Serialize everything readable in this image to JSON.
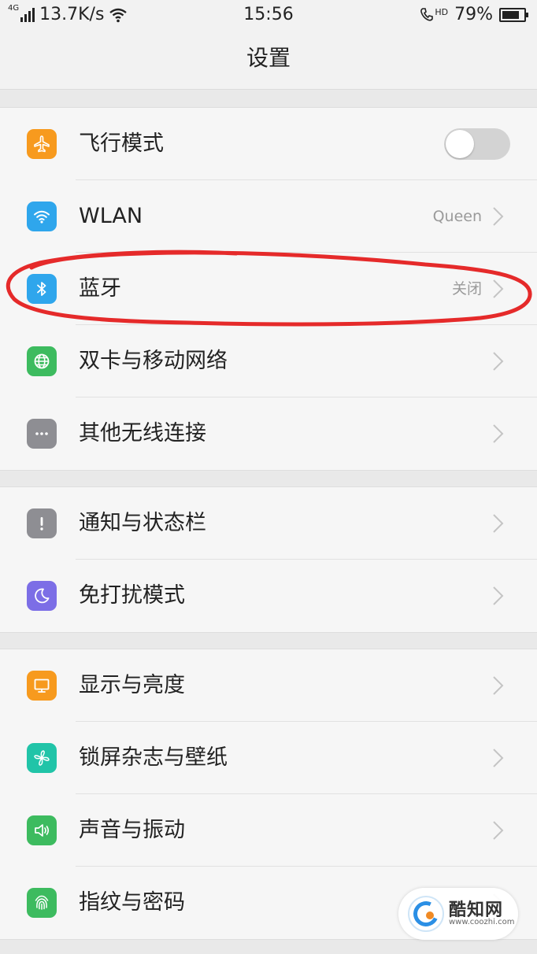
{
  "status_bar": {
    "network_type": "4G",
    "speed": "13.7K/s",
    "time": "15:56",
    "call_indicator": "HD",
    "battery_percent": "79%",
    "battery_level": 0.79
  },
  "header": {
    "title": "设置"
  },
  "groups": [
    {
      "items": [
        {
          "label": "飞行模式",
          "icon": "airplane-icon",
          "icon_color": "#f79a1e",
          "control": "toggle",
          "toggle_on": false
        },
        {
          "label": "WLAN",
          "icon": "wifi-icon",
          "icon_color": "#2fa6ec",
          "value": "Queen",
          "control": "chevron"
        },
        {
          "label": "蓝牙",
          "icon": "bluetooth-icon",
          "icon_color": "#2fa6ec",
          "value": "关闭",
          "control": "chevron"
        },
        {
          "label": "双卡与移动网络",
          "icon": "globe-icon",
          "icon_color": "#3dbb5f",
          "control": "chevron"
        },
        {
          "label": "其他无线连接",
          "icon": "more-icon",
          "icon_color": "#8e8e93",
          "control": "chevron"
        }
      ]
    },
    {
      "items": [
        {
          "label": "通知与状态栏",
          "icon": "notification-icon",
          "icon_color": "#8e8e93",
          "control": "chevron"
        },
        {
          "label": "免打扰模式",
          "icon": "moon-icon",
          "icon_color": "#7c6ee6",
          "control": "chevron"
        }
      ]
    },
    {
      "items": [
        {
          "label": "显示与亮度",
          "icon": "display-icon",
          "icon_color": "#f79a1e",
          "control": "chevron"
        },
        {
          "label": "锁屏杂志与壁纸",
          "icon": "pinwheel-icon",
          "icon_color": "#21c4a8",
          "control": "chevron"
        },
        {
          "label": "声音与振动",
          "icon": "speaker-icon",
          "icon_color": "#3dbb5f",
          "control": "chevron"
        },
        {
          "label": "指纹与密码",
          "icon": "fingerprint-icon",
          "icon_color": "#3dbb5f",
          "control": "chevron"
        }
      ]
    }
  ],
  "annotation_color": "#e52a2a",
  "watermark": {
    "name": "酷知网",
    "url": "www.coozhi.com"
  }
}
